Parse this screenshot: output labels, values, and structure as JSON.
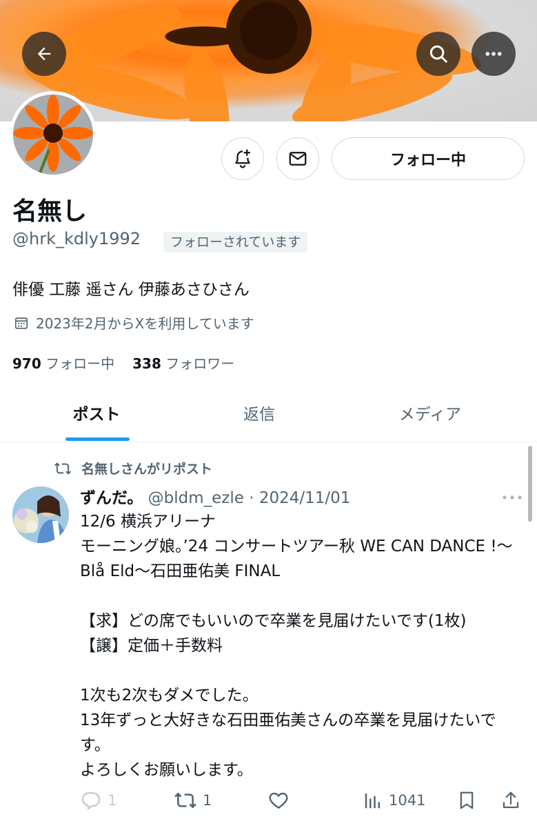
{
  "header": {
    "back_icon": "arrow-left-icon",
    "search_icon": "search-icon",
    "more_icon": "more-horizontal-icon"
  },
  "profile": {
    "display_name": "名無し",
    "handle": "@hrk_kdly1992",
    "follows_you_badge": "フォローされています",
    "bio": "俳優 工藤 遥さん 伊藤あさひさん",
    "joined": "2023年2月からXを利用しています",
    "following_count": "970",
    "following_label": "フォロー中",
    "followers_count": "338",
    "followers_label": "フォロワー",
    "follow_button_label": "フォロー中",
    "notify_icon": "bell-plus-icon",
    "message_icon": "envelope-icon"
  },
  "tabs": [
    {
      "label": "ポスト",
      "active": true
    },
    {
      "label": "返信",
      "active": false
    },
    {
      "label": "メディア",
      "active": false
    }
  ],
  "post": {
    "repost_label": "名無しさんがリポスト",
    "author": "ずんだ。",
    "author_handle": "@bldm_ezle",
    "separator": "·",
    "date": "2024/11/01",
    "text": "12/6 横浜アリーナ\nモーニング娘。’24 コンサートツアー秋 WE CAN DANCE !〜Blå Eld〜石田亜佑美 FINAL\n\n【求】どの席でもいいので卒業を見届けたいです(1枚)\n【譲】定価＋手数料\n\n1次も2次もダメでした。\n13年ずっと大好きな石田亜佑美さんの卒業を見届けたいです。\nよろしくお願いします。",
    "reply_count": "1",
    "repost_count": "1",
    "views_count": "1041"
  },
  "colors": {
    "accent": "#1d9bf0",
    "text": "#0f1419",
    "muted": "#536471",
    "border": "#cfd9de"
  }
}
